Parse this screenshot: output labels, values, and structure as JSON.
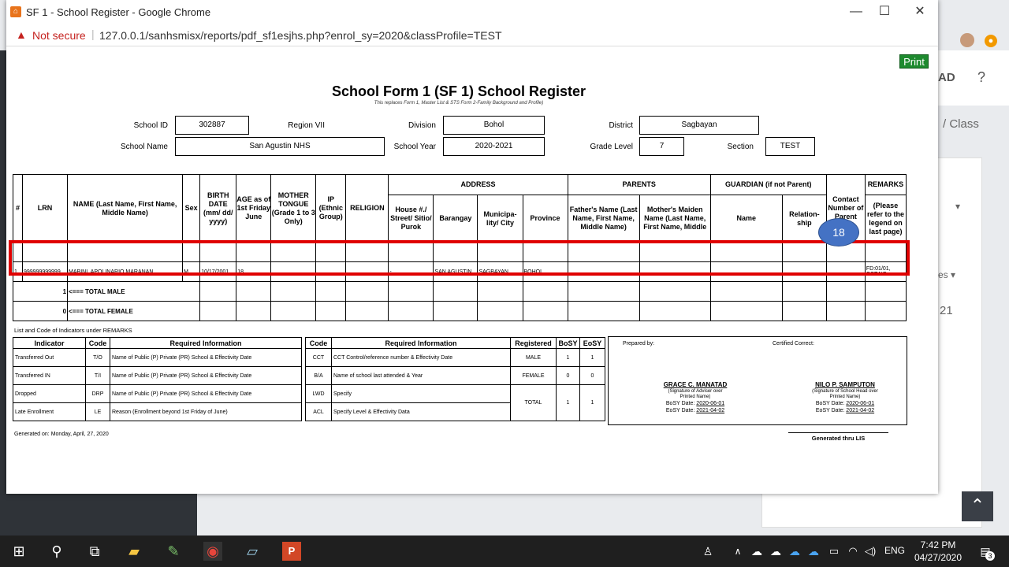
{
  "browser": {
    "title": "SF 1 - School Register - Google Chrome",
    "security": "Not secure",
    "url": "127.0.0.1/sanhsmisx/reports/pdf_sf1esjhs.php?enrol_sy=2020&classProfile=TEST"
  },
  "background": {
    "partial_text_1": "AD",
    "partial_text_2": "/  Class",
    "partial_text_3": "▾",
    "partial_text_4": "es ▾",
    "partial_text_5": "21"
  },
  "form": {
    "print_label": "Print",
    "title": "School Form 1 (SF 1) School Register",
    "subtitle": "This replaces Form 1, Master List & STS Form 2-Family Background and Profile)",
    "school_id_label": "School ID",
    "school_id": "302887",
    "region_label": "Region VII",
    "division_label": "Division",
    "division": "Bohol",
    "district_label": "District",
    "district": "Sagbayan",
    "school_name_label": "School Name",
    "school_name": "San Agustin NHS",
    "school_year_label": "School Year",
    "school_year": "2020-2021",
    "grade_level_label": "Grade Level",
    "grade_level": "7",
    "section_label": "Section",
    "section": "TEST"
  },
  "headers": {
    "num": "#",
    "lrn": "LRN",
    "name": "NAME (Last Name, First Name, Middle Name)",
    "sex": "Sex",
    "birth": "BIRTH DATE (mm/ dd/ yyyy)",
    "age": "AGE as of 1st Friday June",
    "tongue": "MOTHER TONGUE (Grade 1 to 3 Only)",
    "ip": "IP (Ethnic Group)",
    "religion": "RELIGION",
    "address": "ADDRESS",
    "house": "House #./ Street/ Sitio/ Purok",
    "barangay": "Barangay",
    "municipality": "Municipa-lity/ City",
    "province": "Province",
    "parents": "PARENTS",
    "father": "Father's Name (Last Name, First Name, Middle Name)",
    "mother": "Mother's Maiden Name (Last Name, First Name, Middle",
    "guardian": "GUARDIAN (if not Parent)",
    "gname": "Name",
    "relation": "Relation-ship",
    "contact": "Contact Number of Parent",
    "remarks": "REMARKS",
    "remarks_note": "(Please refer to the legend on last page)"
  },
  "student": {
    "num": "1",
    "lrn": "999999999999",
    "name": "MABINI, APOLINARIO MARANAN",
    "sex": "M",
    "birth": "10/17/2001",
    "age": "18",
    "house": "-",
    "barangay": "SAN AGUSTIN",
    "municipality": "SAGBAYAN",
    "province": "BOHOL",
    "father": ",",
    "mother": ",",
    "guardian": ",",
    "remarks": "FD:01/01, CCT:NO"
  },
  "totals": {
    "male_count": "1",
    "male_label": "<=== TOTAL MALE",
    "female_count": "0",
    "female_label": "<=== TOTAL FEMALE"
  },
  "annotation": {
    "badge": "18"
  },
  "legend": {
    "title": "List and Code of Indicators under REMARKS",
    "h_indicator": "Indicator",
    "h_code": "Code",
    "h_info": "Required Information",
    "rows": [
      {
        "indicator": "Transferred Out",
        "code": "T/O",
        "info": "Name of Public (P) Private (PR) School & Effectivity Date"
      },
      {
        "indicator": "Transferred IN",
        "code": "T/I",
        "info": "Name of Public (P) Private (PR) School & Effectivity Date"
      },
      {
        "indicator": "Dropped",
        "code": "DRP",
        "info": "Name of Public (P) Private (PR) School & Effectivity Date"
      },
      {
        "indicator": "Late Enrollment",
        "code": "LE",
        "info": "Reason (Enrollment beyond 1st Friday of June)"
      }
    ],
    "h2_code": "Code",
    "h2_info": "Required Information",
    "h_registered": "Registered",
    "h_bosy": "BoSY",
    "h_eosy": "EoSY",
    "rows2": [
      {
        "code": "CCT",
        "info": "CCT Control/reference number & Effectivity Date"
      },
      {
        "code": "B/A",
        "info": "Name of school last attended & Year"
      },
      {
        "code": "LWD",
        "info": "Specify"
      },
      {
        "code": "ACL",
        "info": "Specify Level & Effectivity Data"
      }
    ],
    "stats": [
      {
        "label": "MALE",
        "bosy": "1",
        "eosy": "1"
      },
      {
        "label": "FEMALE",
        "bosy": "0",
        "eosy": "0"
      },
      {
        "label": "TOTAL",
        "bosy": "1",
        "eosy": "1"
      }
    ]
  },
  "signatures": {
    "prepared_label": "Prepared by:",
    "certified_label": "Certified Correct:",
    "adviser_name": "GRACE C. MANATAD",
    "adviser_role": "(Signature of Adviser over Printed Name)",
    "adviser_bosy_label": "BoSY Date:",
    "adviser_bosy": "2020-06-01",
    "adviser_eosy_label": "EoSY Date:",
    "adviser_eosy": "2021-04-02",
    "head_name": "NILO P. SAMPUTON",
    "head_role": "(Signature of School Head over Printed Name)",
    "head_bosy_label": "BoSY Date:",
    "head_bosy": "2020-06-01",
    "head_eosy_label": "EoSY Date:",
    "head_eosy": "2021-04-02"
  },
  "footer": {
    "generated_on": "Generated on: Monday, April, 27, 2020",
    "generated_thru": "Generated thru LIS"
  },
  "taskbar": {
    "lang": "ENG",
    "time": "7:42 PM",
    "date": "04/27/2020",
    "notif_count": "3"
  }
}
